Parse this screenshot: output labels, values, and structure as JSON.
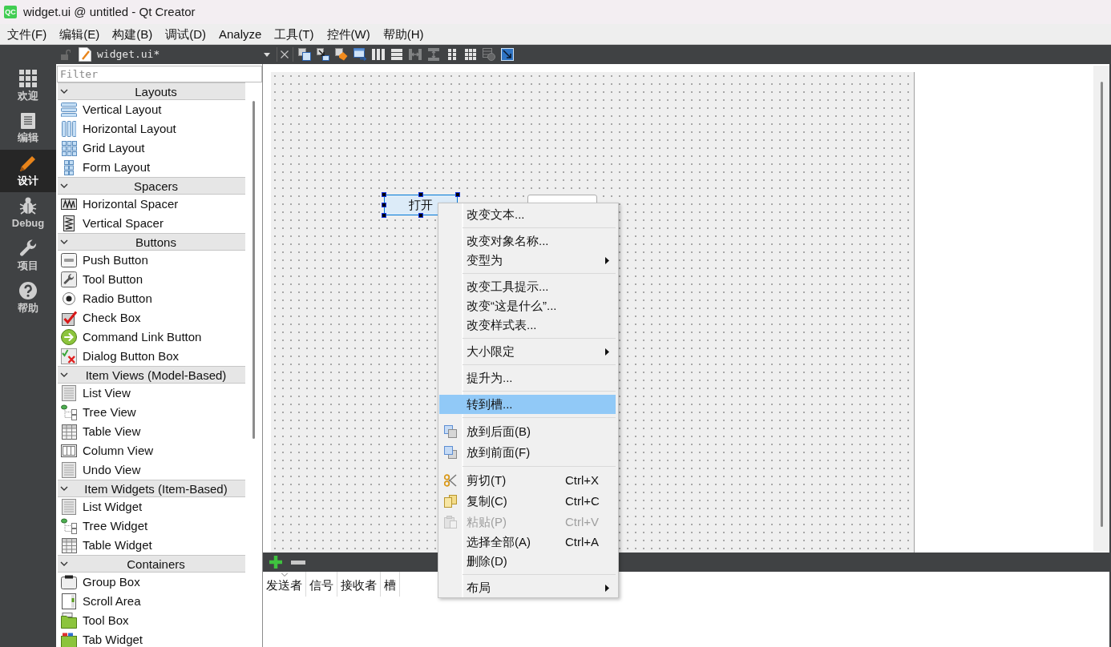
{
  "window": {
    "logo": "QC",
    "title": "widget.ui @ untitled - Qt Creator"
  },
  "menu_bar": [
    "文件(F)",
    "编辑(E)",
    "构建(B)",
    "调试(D)",
    "Analyze",
    "工具(T)",
    "控件(W)",
    "帮助(H)"
  ],
  "modes": [
    {
      "label": "欢迎",
      "selected": false
    },
    {
      "label": "编辑",
      "selected": false
    },
    {
      "label": "设计",
      "selected": true
    },
    {
      "label": "Debug",
      "selected": false
    },
    {
      "label": "项目",
      "selected": false
    },
    {
      "label": "帮助",
      "selected": false
    }
  ],
  "document": {
    "name": "widget.ui*"
  },
  "form_toolbar": [
    {
      "disabled": false
    },
    {
      "disabled": false
    },
    {
      "disabled": false
    },
    {
      "disabled": false
    },
    {
      "disabled": false
    },
    {
      "disabled": false
    },
    {
      "disabled": true
    },
    {
      "disabled": true
    },
    {
      "disabled": false
    },
    {
      "disabled": false
    },
    {
      "disabled": true
    },
    {
      "disabled": false
    }
  ],
  "widget_box": {
    "filter": {
      "placeholder": "Filter"
    },
    "categories": [
      {
        "title": "Layouts",
        "expanded": true,
        "items": [
          "Vertical Layout",
          "Horizontal Layout",
          "Grid Layout",
          "Form Layout"
        ]
      },
      {
        "title": "Spacers",
        "expanded": true,
        "items": [
          "Horizontal Spacer",
          "Vertical Spacer"
        ]
      },
      {
        "title": "Buttons",
        "expanded": true,
        "items": [
          "Push Button",
          "Tool Button",
          "Radio Button",
          "Check Box",
          "Command Link Button",
          "Dialog Button Box"
        ]
      },
      {
        "title": "Item Views (Model-Based)",
        "expanded": true,
        "items": [
          "List View",
          "Tree View",
          "Table View",
          "Column View",
          "Undo View"
        ]
      },
      {
        "title": "Item Widgets (Item-Based)",
        "expanded": true,
        "items": [
          "List Widget",
          "Tree Widget",
          "Table Widget"
        ]
      },
      {
        "title": "Containers",
        "expanded": true,
        "items": [
          "Group Box",
          "Scroll Area",
          "Tool Box",
          "Tab Widget"
        ]
      }
    ]
  },
  "form": {
    "widgets": [
      {
        "text": "打开",
        "selected": true
      },
      {
        "selected": false
      }
    ]
  },
  "context_menu": {
    "groups": [
      {
        "items": [
          {
            "label": "改变文本...",
            "selected": false,
            "disabled": false,
            "submenu": false
          }
        ]
      },
      {
        "items": [
          {
            "label": "改变对象名称...",
            "selected": false,
            "disabled": false,
            "submenu": false
          },
          {
            "label": "变型为",
            "selected": false,
            "disabled": false,
            "submenu": true
          }
        ]
      },
      {
        "items": [
          {
            "label": "改变工具提示...",
            "selected": false,
            "disabled": false,
            "submenu": false
          },
          {
            "label": "改变“这是什么”...",
            "selected": false,
            "disabled": false,
            "submenu": false
          },
          {
            "label": "改变样式表...",
            "selected": false,
            "disabled": false,
            "submenu": false
          }
        ]
      },
      {
        "items": [
          {
            "label": "大小限定",
            "selected": false,
            "disabled": false,
            "submenu": true
          }
        ]
      },
      {
        "items": [
          {
            "label": "提升为...",
            "selected": false,
            "disabled": false,
            "submenu": false
          }
        ]
      },
      {
        "items": [
          {
            "label": "转到槽...",
            "selected": true,
            "disabled": false,
            "submenu": false
          }
        ]
      },
      {
        "items": [
          {
            "label": "放到后面(B)",
            "selected": false,
            "disabled": false,
            "submenu": false
          },
          {
            "label": "放到前面(F)",
            "selected": false,
            "disabled": false,
            "submenu": false
          }
        ]
      },
      {
        "items": [
          {
            "label": "剪切(T)",
            "shortcut": "Ctrl+X",
            "selected": false,
            "disabled": false,
            "submenu": false
          },
          {
            "label": "复制(C)",
            "shortcut": "Ctrl+C",
            "selected": false,
            "disabled": false,
            "submenu": false
          },
          {
            "label": "粘贴(P)",
            "shortcut": "Ctrl+V",
            "selected": false,
            "disabled": true,
            "submenu": false
          },
          {
            "label": "选择全部(A)",
            "shortcut": "Ctrl+A",
            "selected": false,
            "disabled": false,
            "submenu": false
          },
          {
            "label": "删除(D)",
            "selected": false,
            "disabled": false,
            "submenu": false
          }
        ]
      },
      {
        "items": [
          {
            "label": "布局",
            "selected": false,
            "disabled": false,
            "submenu": true
          }
        ]
      }
    ]
  },
  "signal_slot_editor": {
    "columns": [
      {
        "label": "发送者",
        "sorted": true
      },
      {
        "label": "信号",
        "sorted": false
      },
      {
        "label": "接收者",
        "sorted": false
      },
      {
        "label": "槽",
        "sorted": false
      }
    ]
  }
}
